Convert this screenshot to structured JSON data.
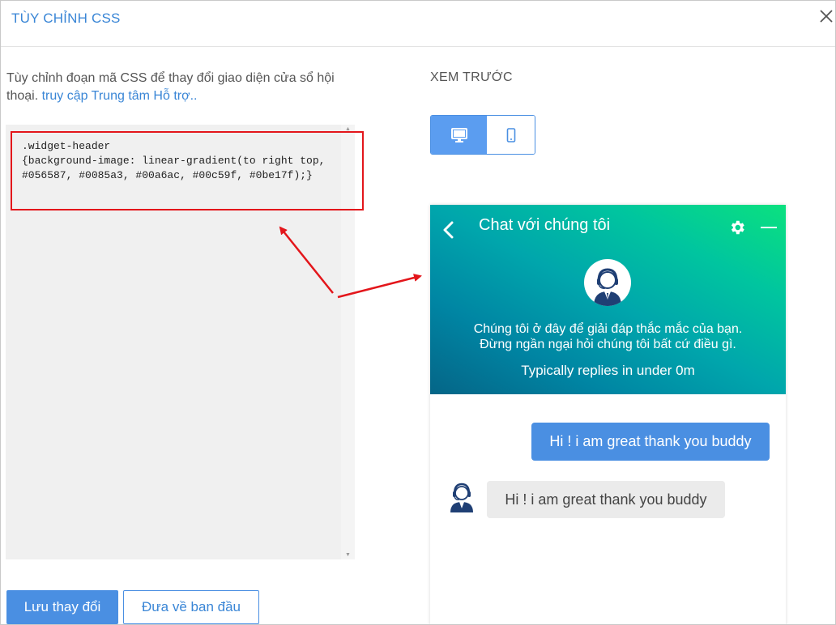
{
  "dialog": {
    "title": "TÙY CHỈNH CSS",
    "close_icon": "close-icon"
  },
  "editor": {
    "description_text": "Tùy chỉnh đoạn mã CSS để thay đổi giao diện cửa sổ hội thoại.",
    "help_link": "truy cập Trung tâm Hỗ trợ..",
    "code": ".widget-header\n{background-image: linear-gradient(to right top, #056587, #0085a3, #00a6ac, #00c59f, #0be17f);}",
    "highlight_color": "#e3161b"
  },
  "buttons": {
    "save_label": "Lưu thay đổi",
    "reset_label": "Đưa về ban đầu"
  },
  "preview": {
    "label": "XEM TRƯỚC",
    "toggle": [
      {
        "name": "desktop",
        "icon": "desktop-icon",
        "active": true
      },
      {
        "name": "mobile",
        "icon": "mobile-icon",
        "active": false
      }
    ]
  },
  "widget": {
    "title": "Chat với chúng tôi",
    "intro_line1": "Chúng tôi ở đây để giải đáp thắc mắc của bạn.",
    "intro_line2": "Đừng ngần ngại hỏi chúng tôi bất cứ điều gì.",
    "reply_time": "Typically replies in under 0m",
    "gradient_colors": [
      "#056587",
      "#0085a3",
      "#00a6ac",
      "#00c59f",
      "#0be17f"
    ],
    "messages": [
      {
        "from": "visitor",
        "text": "Hi ! i am great thank you buddy"
      },
      {
        "from": "agent",
        "text": "Hi ! i am great thank you buddy"
      }
    ]
  }
}
